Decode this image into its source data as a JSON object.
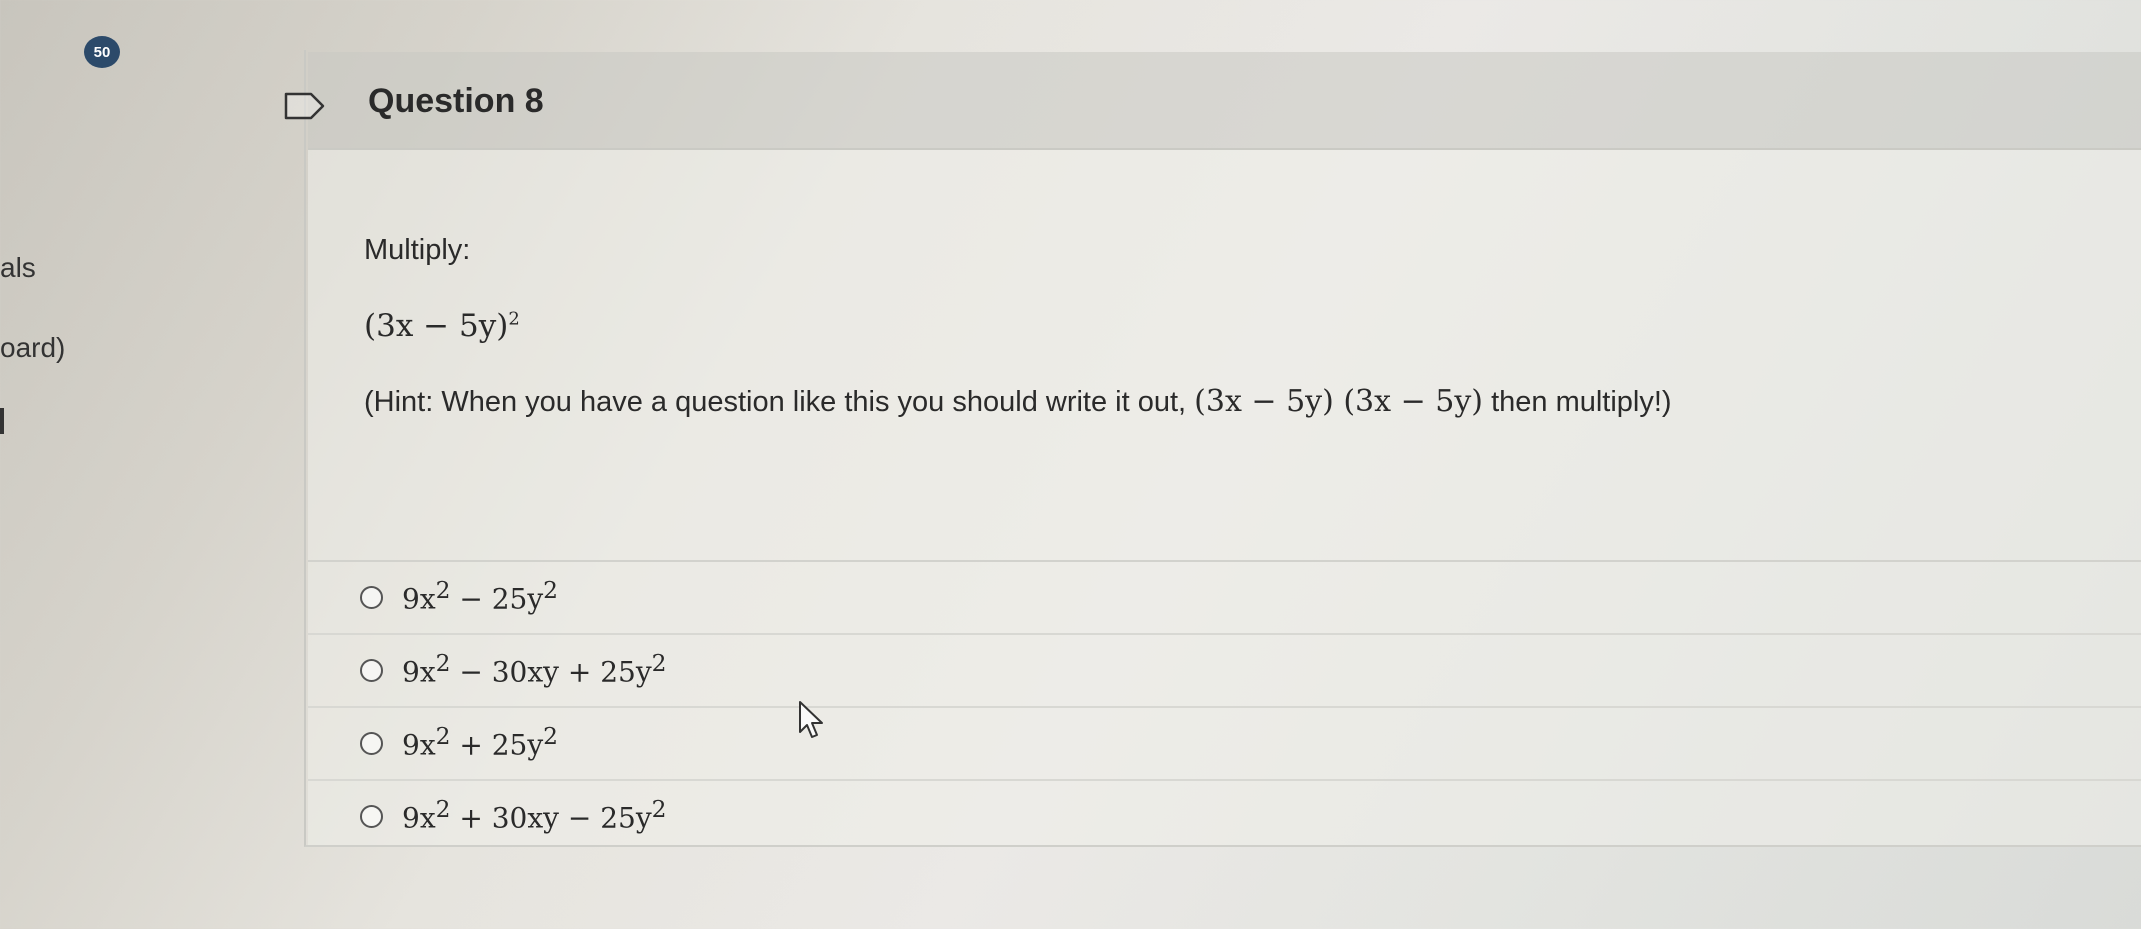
{
  "badge": {
    "count": "50"
  },
  "sidebar": {
    "items": [
      {
        "label": "als"
      },
      {
        "label": "oard)"
      }
    ]
  },
  "question": {
    "title": "Question 8",
    "prompt": "Multiply:",
    "expression": {
      "base": "(3x − 5y)",
      "exponent": "2"
    },
    "hint": {
      "prefix": "(Hint: When you have a question like this you should write it out, ",
      "math": "(3x − 5y) (3x − 5y)",
      "suffix": " then multiply!)"
    },
    "options": [
      {
        "parts": [
          "9x",
          "2",
          " − 25y",
          "2",
          ""
        ]
      },
      {
        "parts": [
          "9x",
          "2",
          " − 30xy + 25y",
          "2",
          ""
        ]
      },
      {
        "parts": [
          "9x",
          "2",
          " + 25y",
          "2",
          ""
        ]
      },
      {
        "parts": [
          "9x",
          "2",
          " + 30xy − 25y",
          "2",
          ""
        ]
      }
    ]
  },
  "icons": {
    "flag": "flag-icon",
    "cursor": "mouse-cursor-icon",
    "radio": "radio-button-icon"
  },
  "colors": {
    "badge_bg": "#2c4a6a",
    "header_bg": "#c8c8c2",
    "text": "#2a2a2a"
  }
}
